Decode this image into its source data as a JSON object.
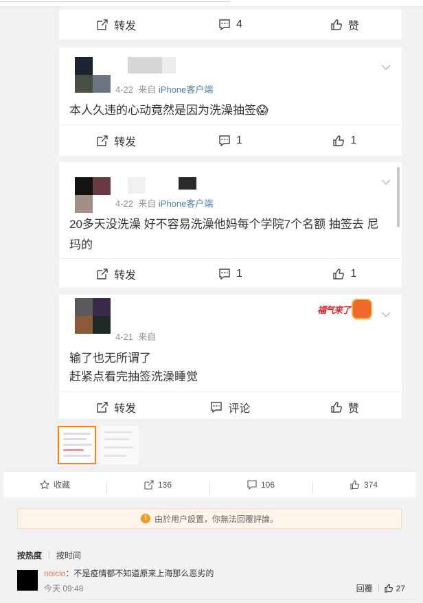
{
  "cards": [
    {
      "actions": {
        "forward": "转发",
        "comment": "4",
        "like": "赞"
      }
    },
    {
      "date": "4-22",
      "source_prefix": "来自",
      "source": "iPhone客户端",
      "text": "本人久违的心动竟然是因为洗澡抽签😱",
      "actions": {
        "forward": "转发",
        "comment": "1",
        "like": "1"
      },
      "avatar_colors": [
        "#1b2430",
        "#ffffff",
        "#4a4f45",
        "#6c7680"
      ]
    },
    {
      "date": "4-22",
      "source_prefix": "来自",
      "source": "iPhone客户端",
      "text": "20多天没洗澡 好不容易洗澡他妈每个学院7个名额 抽签去 尼玛的",
      "actions": {
        "forward": "转发",
        "comment": "1",
        "like": "1"
      },
      "avatar_colors": [
        "#121212",
        "#6a3b42",
        "#a38e88",
        "#ffffff"
      ]
    },
    {
      "date": "4-21",
      "source_prefix": "来自",
      "text_line1": "输了也无所谓了",
      "text_line2": "赶紧点看完抽签洗澡睡觉",
      "sticker": "福气来了",
      "actions": {
        "forward": "转发",
        "comment": "评论",
        "like": "赞"
      },
      "avatar_colors": [
        "#5a5a5a",
        "#3a2a4a",
        "#8a5a3a",
        "#1e2a25"
      ]
    }
  ],
  "stats": {
    "favorite": "收藏",
    "forward": "136",
    "comment": "106",
    "like": "374"
  },
  "notice": "由於用户設置，你無法回覆評論。",
  "sort": {
    "hot": "按热度",
    "time": "按时间"
  },
  "comment": {
    "user": "noicio",
    "text": "：不是疫情都不知道原来上海那么恶劣的",
    "time": "今天 09:48",
    "reply": "回覆",
    "likes": "27"
  },
  "colors": {
    "accent": "#ff8200",
    "link": "#507daf",
    "username": "#eb7350"
  }
}
